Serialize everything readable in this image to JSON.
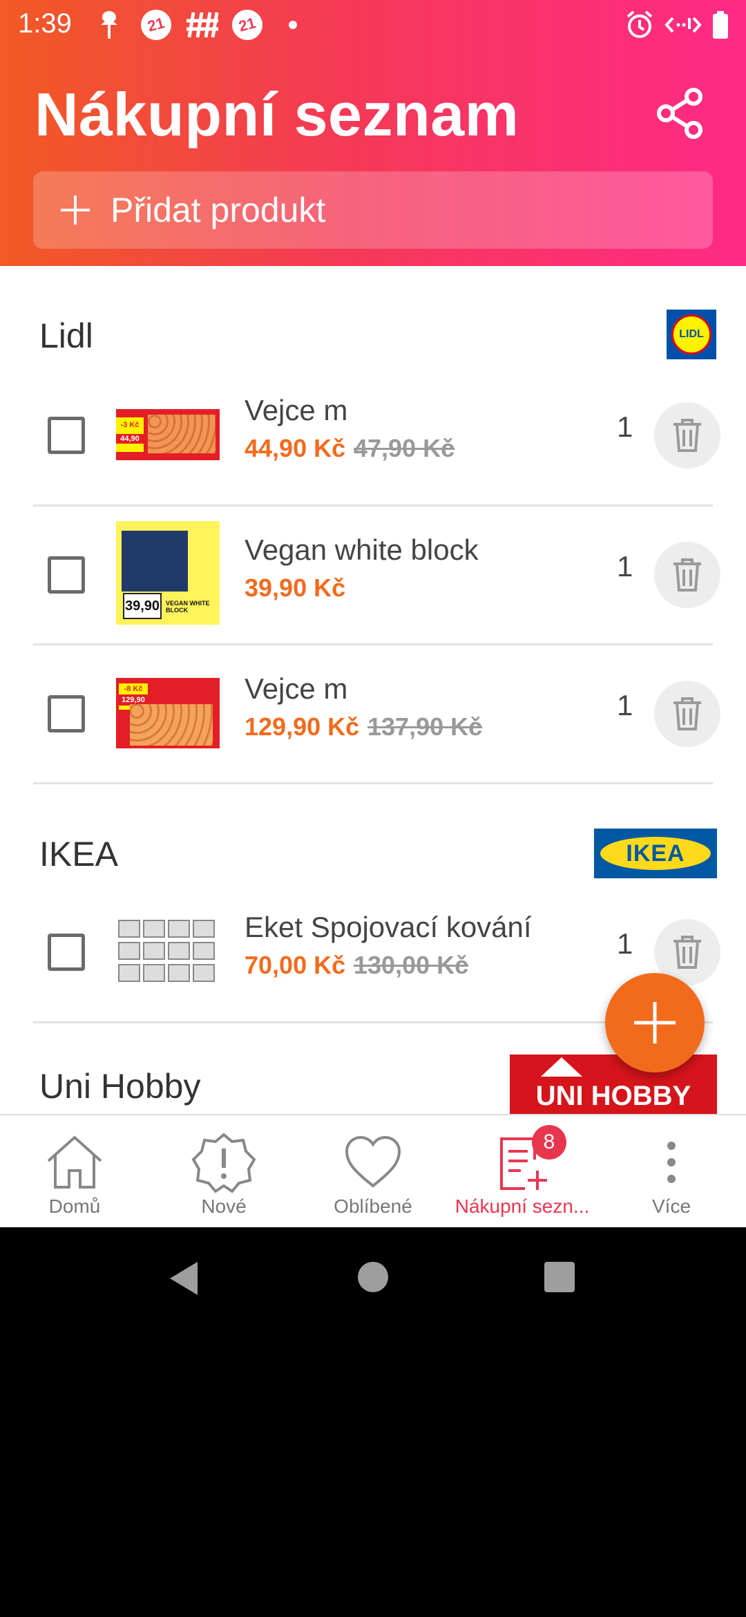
{
  "status_bar": {
    "time": "1:39",
    "badge_a": "21",
    "badge_b": "21",
    "icons": [
      "pin-icon",
      "calendar-21-icon",
      "hashtag-icon",
      "calendar-21-icon",
      "dot-icon",
      "alarm-icon",
      "data-icon",
      "battery-icon"
    ]
  },
  "header": {
    "title": "Nákupní seznam",
    "add_label": "Přidat produkt"
  },
  "stores": [
    {
      "name": "Lidl",
      "logo_text": "LIDL",
      "items": [
        {
          "name": "Vejce m",
          "price": "44,90 Kč",
          "old_price": "47,90 Kč",
          "qty": "1",
          "thumb_price": "44,90",
          "thumb_tag": "-3 Kč"
        },
        {
          "name": "Vegan white block",
          "price": "39,90 Kč",
          "old_price": "",
          "qty": "1",
          "thumb_price": "39,90",
          "thumb_tag": "VEGAN WHITE BLOCK"
        },
        {
          "name": "Vejce m",
          "price": "129,90 Kč",
          "old_price": "137,90 Kč",
          "qty": "1",
          "thumb_price": "129,90",
          "thumb_tag": "-8 Kč"
        }
      ]
    },
    {
      "name": "IKEA",
      "logo_text": "IKEA",
      "items": [
        {
          "name": "Eket Spojovací kování",
          "price": "70,00 Kč",
          "old_price": "130,00 Kč",
          "qty": "1"
        }
      ]
    },
    {
      "name": "Uni Hobby",
      "logo_text": "UNI HOBBY",
      "items": []
    }
  ],
  "bottom_nav": [
    {
      "label": "Domů",
      "icon": "home-icon"
    },
    {
      "label": "Nové",
      "icon": "alert-badge-icon"
    },
    {
      "label": "Oblíbené",
      "icon": "heart-icon"
    },
    {
      "label": "Nákupní sezn...",
      "icon": "shopping-list-add-icon",
      "badge": "8",
      "active": true
    },
    {
      "label": "Více",
      "icon": "more-vertical-icon"
    }
  ],
  "colors": {
    "accent": "#f26b1d",
    "active": "#e8364f",
    "header_gradient": [
      "#f15a24",
      "#ff2a86"
    ]
  }
}
